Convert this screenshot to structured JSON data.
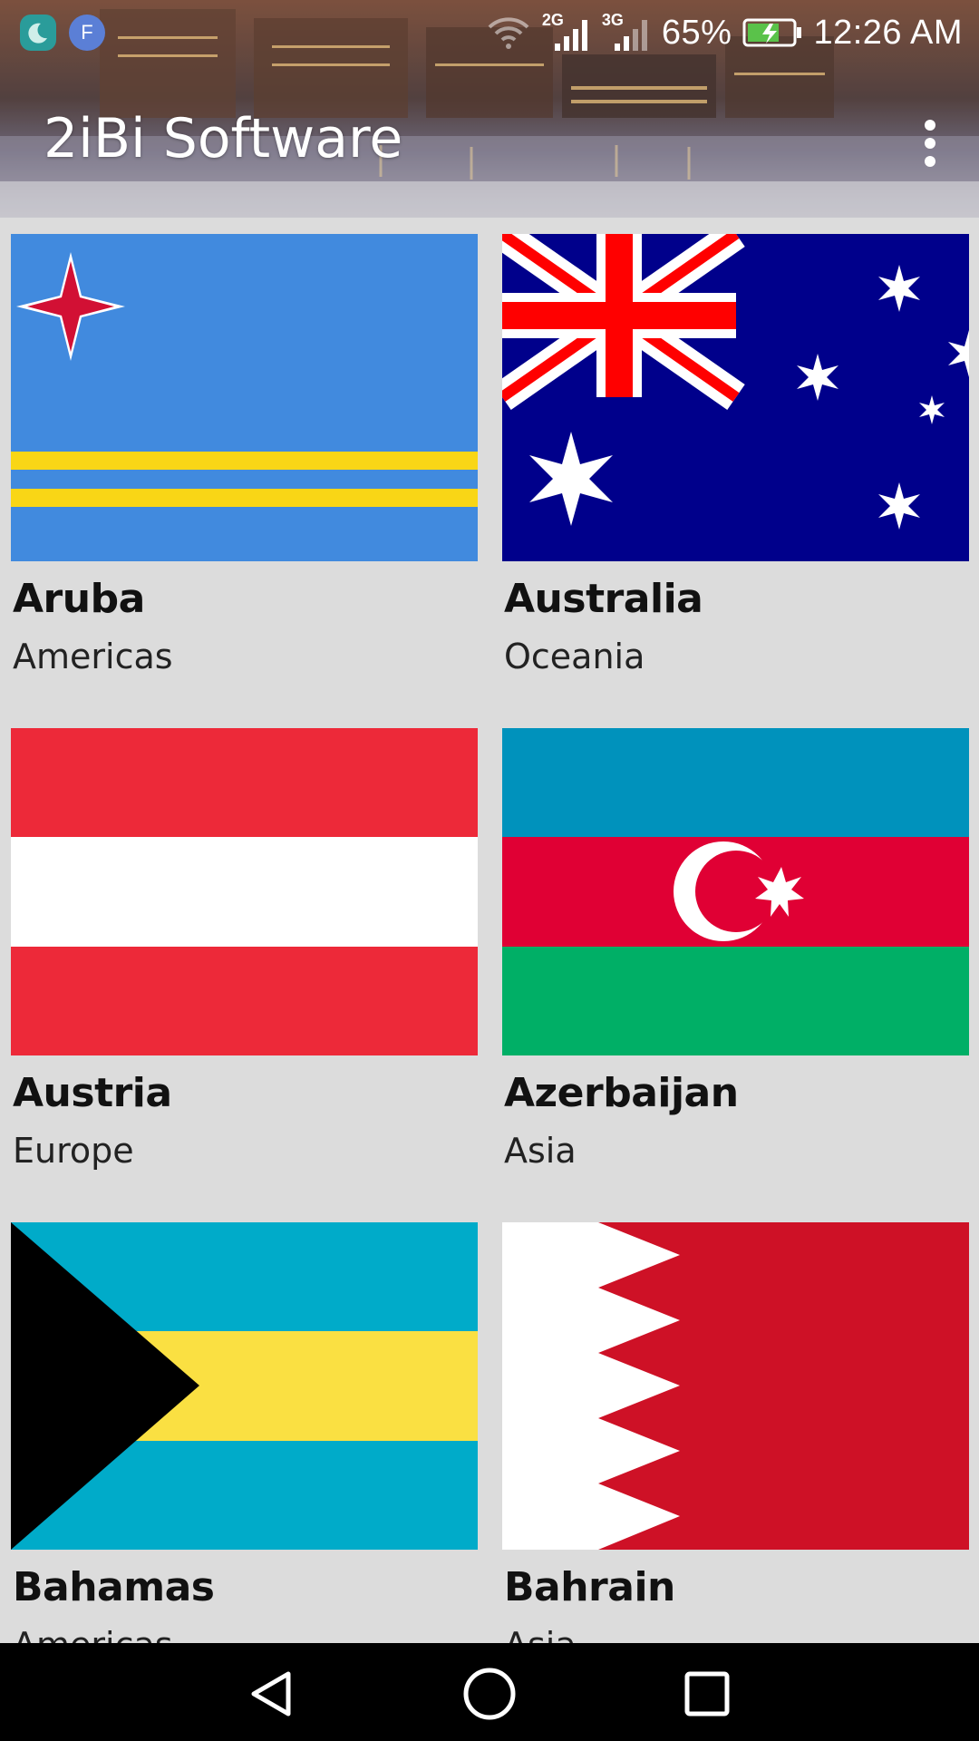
{
  "status_bar": {
    "net1": "2G",
    "net2": "3G",
    "battery": "65%",
    "time": "12:26 AM",
    "notif_f": "F"
  },
  "app_bar": {
    "title": "2iBi Software",
    "menu_icon": "more-vert-icon"
  },
  "countries": [
    {
      "name": "Aruba",
      "region": "Americas"
    },
    {
      "name": "Australia",
      "region": "Oceania"
    },
    {
      "name": "Austria",
      "region": "Europe"
    },
    {
      "name": "Azerbaijan",
      "region": "Asia"
    },
    {
      "name": "Bahamas",
      "region": "Americas"
    },
    {
      "name": "Bahrain",
      "region": "Asia"
    }
  ],
  "nav": {
    "back_icon": "back-triangle-icon",
    "home_icon": "home-circle-icon",
    "recents_icon": "recents-square-icon"
  },
  "colors": {
    "background": "#dcdcdc",
    "navbar": "#000000"
  }
}
